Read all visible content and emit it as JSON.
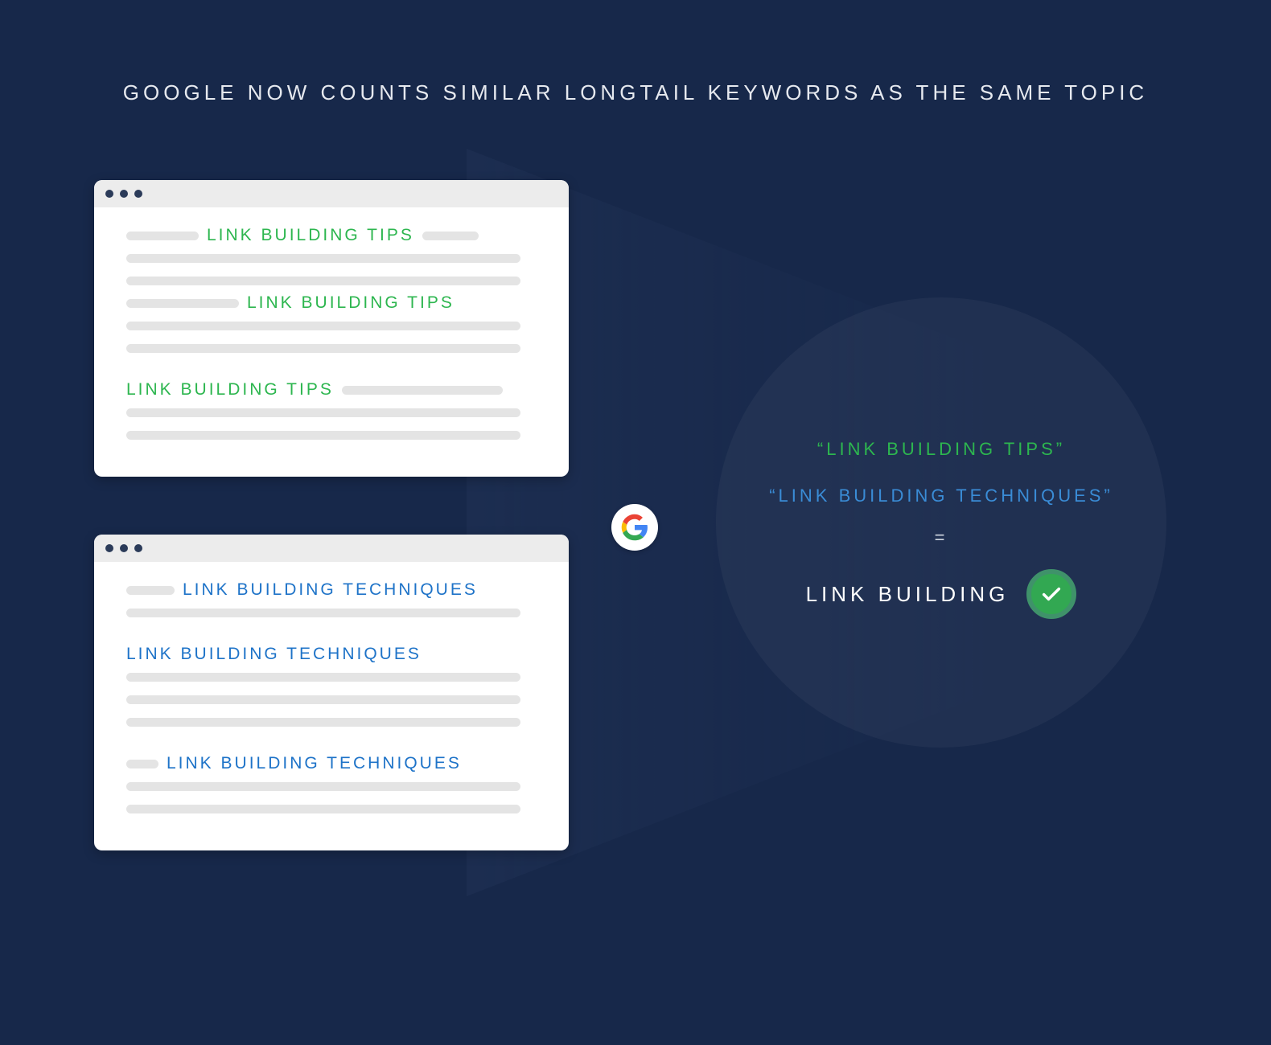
{
  "title": "GOOGLE NOW COUNTS SIMILAR LONGTAIL KEYWORDS AS THE  SAME TOPIC",
  "browser_top": {
    "keyword": "LINK BUILDING TIPS"
  },
  "browser_bottom": {
    "keyword": "LINK BUILDING TECHNIQUES"
  },
  "circle": {
    "line1": "“LINK BUILDING TIPS”",
    "line2": "“LINK BUILDING TECHNIQUES”",
    "equals": "=",
    "result": "LINK BUILDING"
  }
}
